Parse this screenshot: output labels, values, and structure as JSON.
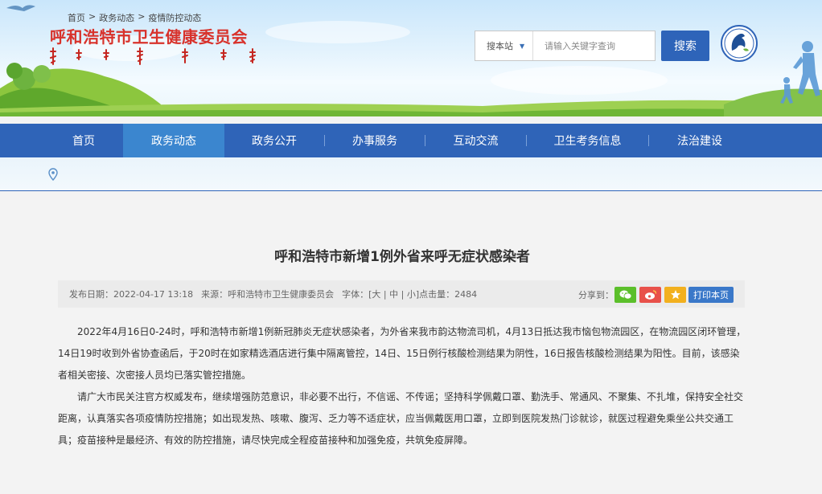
{
  "header": {
    "site_title": "呼和浩特市卫生健康委员会",
    "search": {
      "scope_label": "搜本站",
      "placeholder": "请输入关键字查询",
      "button_label": "搜索"
    }
  },
  "nav": {
    "items": [
      {
        "label": "首页"
      },
      {
        "label": "政务动态"
      },
      {
        "label": "政务公开"
      },
      {
        "label": "办事服务"
      },
      {
        "label": "互动交流"
      },
      {
        "label": "卫生考务信息"
      },
      {
        "label": "法治建设"
      }
    ],
    "active_index": 1
  },
  "breadcrumb": {
    "items": [
      "首页",
      "政务动态",
      "疫情防控动态"
    ],
    "separator": ">"
  },
  "article": {
    "title": "呼和浩特市新增1例外省来呼无症状感染者",
    "meta": {
      "date_label": "发布日期：",
      "date": "2022-04-17 13:18",
      "source_label": "来源：",
      "source": "呼和浩特市卫生健康委员会",
      "font_label": "字体：",
      "font_options": "[大 | 中 | 小]",
      "clicks_label": "点击量：",
      "clicks": "2484"
    },
    "share_label": "分享到：",
    "share_buttons": [
      {
        "name": "wechat",
        "color": "#5bbf2a"
      },
      {
        "name": "weibo",
        "color": "#e8514a"
      },
      {
        "name": "favorite",
        "color": "#f2b01e"
      }
    ],
    "print_label": "打印本页",
    "paragraphs": [
      "2022年4月16日0-24时，呼和浩特市新增1例新冠肺炎无症状感染者，为外省来我市韵达物流司机，4月13日抵达我市恼包物流园区，在物流园区闭环管理，14日19时收到外省协查函后，于20时在如家精选酒店进行集中隔离管控，14日、15日例行核酸检测结果为阴性，16日报告核酸检测结果为阳性。目前，该感染者相关密接、次密接人员均已落实管控措施。",
      "请广大市民关注官方权威发布，继续增强防范意识，非必要不出行，不信谣、不传谣；坚持科学佩戴口罩、勤洗手、常通风、不聚集、不扎堆，保持安全社交距离，认真落实各项疫情防控措施；如出现发热、咳嗽、腹泻、乏力等不适症状，应当佩戴医用口罩，立即到医院发热门诊就诊，就医过程避免乘坐公共交通工具；疫苗接种是最经济、有效的防控措施，请尽快完成全程疫苗接种和加强免疫，共筑免疫屏障。"
    ]
  },
  "colors": {
    "nav_bg": "#2f64b8",
    "nav_active": "#3b86cf",
    "title_red": "#d8322b",
    "search_button": "#2e64b9"
  }
}
